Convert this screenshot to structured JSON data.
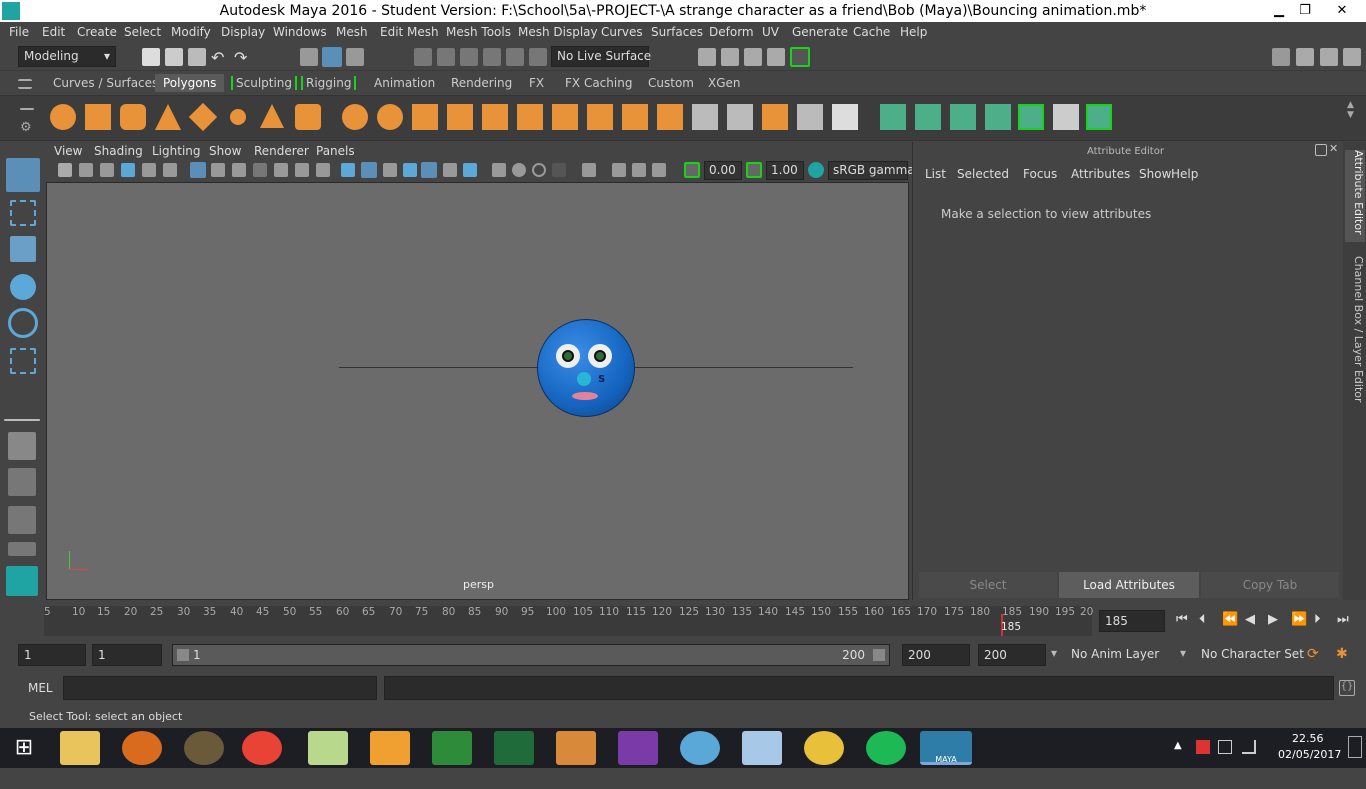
{
  "window": {
    "title": "Autodesk Maya 2016 - Student Version: F:\\School\\5a\\-PROJECT-\\A strange character as a friend\\Bob (Maya)\\Bouncing animation.mb*",
    "minimize": "▁",
    "maximize": "❐",
    "close": "✕"
  },
  "menus": [
    "File",
    "Edit",
    "Create",
    "Select",
    "Modify",
    "Display",
    "Windows",
    "Mesh",
    "Edit Mesh",
    "Mesh Tools",
    "Mesh Display",
    "Curves",
    "Surfaces",
    "Deform",
    "UV",
    "Generate",
    "Cache",
    "Help"
  ],
  "status": {
    "mode": "Modeling",
    "live_surface": "No Live Surface"
  },
  "shelf_tabs": [
    "Curves / Surfaces",
    "Polygons",
    "Sculpting",
    "Rigging",
    "Animation",
    "Rendering",
    "FX",
    "FX Caching",
    "Custom",
    "XGen"
  ],
  "shelf_active": "Polygons",
  "panel_menus": [
    "View",
    "Shading",
    "Lighting",
    "Show",
    "Renderer",
    "Panels"
  ],
  "panel_toolbar": {
    "value1": "0.00",
    "value2": "1.00",
    "color_space": "sRGB gamma"
  },
  "viewport": {
    "camera": "persp",
    "character_label": "S"
  },
  "attribute_editor": {
    "header": "Attribute Editor",
    "menus": [
      "List",
      "Selected",
      "Focus",
      "Attributes",
      "Show",
      "Help"
    ],
    "message": "Make a selection to view attributes",
    "buttons": {
      "select": "Select",
      "load": "Load Attributes",
      "copy": "Copy Tab"
    }
  },
  "side_tabs": {
    "attr": "Attribute Editor",
    "channel": "Channel Box / Layer Editor"
  },
  "timeline": {
    "ticks": [
      "5",
      "10",
      "15",
      "20",
      "25",
      "30",
      "35",
      "40",
      "45",
      "50",
      "55",
      "60",
      "65",
      "70",
      "75",
      "80",
      "85",
      "90",
      "95",
      "100",
      "105",
      "110",
      "115",
      "120",
      "125",
      "130",
      "135",
      "140",
      "145",
      "150",
      "155",
      "160",
      "165",
      "170",
      "175",
      "180",
      "185",
      "190",
      "195",
      "20"
    ],
    "current_marker": "185",
    "current_frame": "185"
  },
  "range": {
    "start": "1",
    "playback_start": "1",
    "slider_start": "1",
    "slider_end": "200",
    "playback_end": "200",
    "end": "200",
    "anim_layer": "No Anim Layer",
    "character_set": "No Character Set"
  },
  "command": {
    "label": "MEL"
  },
  "help_line": "Select Tool: select an object",
  "taskbar": {
    "time": "22.56",
    "date": "02/05/2017",
    "maya_label": "MAYA"
  },
  "colors": {
    "accent": "#1fa3a3",
    "shelf_icon": "#e8923a",
    "shelf_icon_green": "#4caf8a",
    "face": "#1565c0"
  }
}
